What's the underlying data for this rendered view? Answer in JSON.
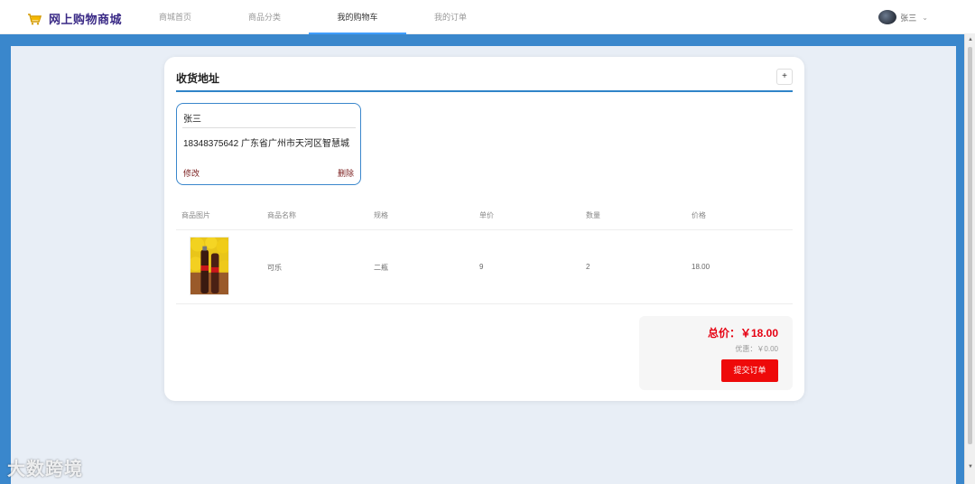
{
  "brand": {
    "title": "网上购物商城",
    "icon": "shopping-cart-icon"
  },
  "nav": {
    "items": [
      {
        "label": "商城首页"
      },
      {
        "label": "商品分类"
      },
      {
        "label": "我的购物车"
      },
      {
        "label": "我的订单"
      }
    ],
    "active": "我的购物车"
  },
  "user": {
    "name": "张三"
  },
  "address_section": {
    "title": "收货地址",
    "add_label": "+",
    "address": {
      "name": "张三",
      "detail": "18348375642 广东省广州市天河区智慧城",
      "edit_label": "修改",
      "delete_label": "删除"
    }
  },
  "table": {
    "headers": [
      "商品图片",
      "商品名称",
      "规格",
      "单价",
      "数量",
      "价格"
    ],
    "rows": [
      {
        "name": "可乐",
        "spec": "二瓶",
        "price": "9",
        "qty": "2",
        "total": "18.00"
      }
    ]
  },
  "summary": {
    "total": "总价：￥18.00",
    "discount": "优惠：￥0.00",
    "submit_label": "提交订单"
  },
  "watermark": "大数跨境",
  "colors": {
    "accent": "#409eff",
    "frame": "#3a87cc",
    "brand": "#3a2a86",
    "danger": "#e60012"
  }
}
